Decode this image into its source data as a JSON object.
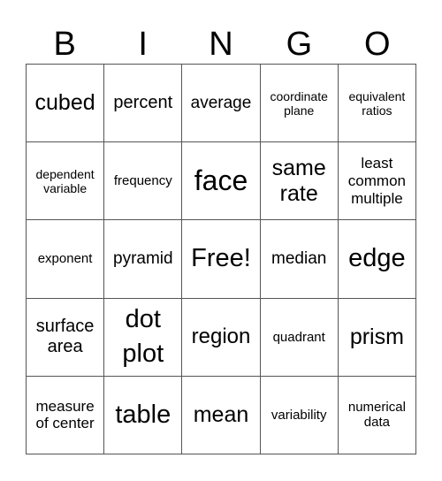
{
  "header": {
    "letters": [
      "B",
      "I",
      "N",
      "G",
      "O"
    ]
  },
  "board": [
    [
      "cubed",
      "percent",
      "average",
      "coordinate plane",
      "equivalent ratios"
    ],
    [
      "dependent variable",
      "frequency",
      "face",
      "same rate",
      "least common multiple"
    ],
    [
      "exponent",
      "pyramid",
      "Free!",
      "median",
      "edge"
    ],
    [
      "surface area",
      "dot plot",
      "region",
      "quadrant",
      "prism"
    ],
    [
      "measure of center",
      "table",
      "mean",
      "variability",
      "numerical data"
    ]
  ]
}
